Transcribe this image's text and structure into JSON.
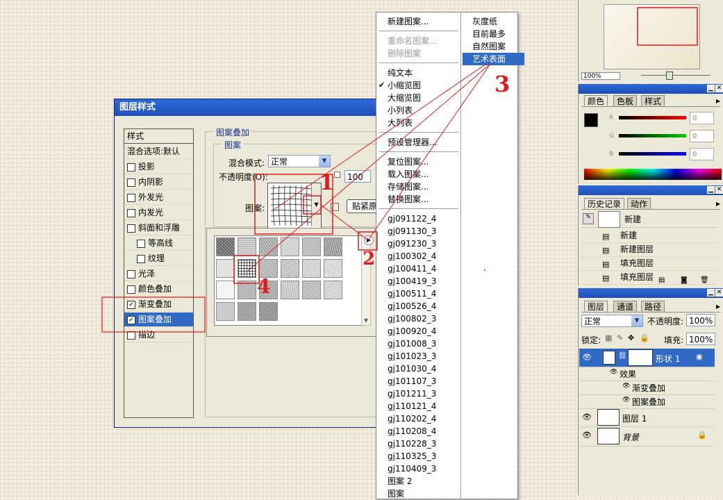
{
  "dialog": {
    "title": "图层样式",
    "styles_header": "样式",
    "blend_options": "混合选项:默认",
    "items": [
      {
        "label": "投影",
        "checked": false
      },
      {
        "label": "内阴影",
        "checked": false
      },
      {
        "label": "外发光",
        "checked": false
      },
      {
        "label": "内发光",
        "checked": false
      },
      {
        "label": "斜面和浮雕",
        "checked": false
      },
      {
        "label": "等高线",
        "checked": false
      },
      {
        "label": "纹理",
        "checked": false
      },
      {
        "label": "光泽",
        "checked": false
      },
      {
        "label": "颜色叠加",
        "checked": false
      },
      {
        "label": "渐变叠加",
        "checked": true
      },
      {
        "label": "图案叠加",
        "checked": true
      },
      {
        "label": "描边",
        "checked": false
      }
    ],
    "section_title": "图案叠加",
    "subsection_title": "图案",
    "blend_mode_label": "混合模式:",
    "blend_mode_value": "正常",
    "opacity_label": "不透明度(O):",
    "opacity_value": "100",
    "pattern_label": "图案:",
    "snap_button": "贴紧原"
  },
  "menu": {
    "col1": {
      "top": [
        "新建图案..."
      ],
      "disabled": [
        "重命名图案...",
        "删除图案"
      ],
      "view": [
        "纯文本",
        "小缩览图",
        "大缩览图",
        "小列表",
        "大列表"
      ],
      "checked_view": "小缩览图",
      "manager": "预设管理器...",
      "actions": [
        "复位图案...",
        "载入图案...",
        "存储图案...",
        "替换图案..."
      ],
      "patterns": [
        "gj091122_4",
        "gj091130_3",
        "gj091230_3",
        "gj100302_4",
        "gj100411_4",
        "gj100419_3",
        "gj100511_4",
        "gj100526_4",
        "gj100802_3",
        "gj100920_4",
        "gj101008_3",
        "gj101023_3",
        "gj101030_4",
        "gj101107_3",
        "gj101211_3",
        "gj110121_4",
        "gj110202_4",
        "gj110208_4",
        "gj110228_3",
        "gj110325_3",
        "gj110409_3",
        "图案 2",
        "图案"
      ]
    },
    "col2": [
      "灰度纸",
      "目前最多",
      "自然图案",
      "艺术表面"
    ],
    "col2_highlight": "艺术表面"
  },
  "panels": {
    "navigator": {
      "zoom": "100%"
    },
    "color": {
      "tabs": [
        "颜色",
        "色板",
        "样式"
      ],
      "channels": [
        "R",
        "G",
        "B"
      ],
      "values": [
        "0",
        "0",
        "0"
      ]
    },
    "history": {
      "tabs": [
        "历史记录",
        "动作"
      ],
      "snapshot": "新建",
      "rows": [
        "新建",
        "新建图层",
        "填充图层",
        "填充图层"
      ]
    },
    "layers": {
      "tabs": [
        "图层",
        "通道",
        "路径"
      ],
      "blend_mode": "正常",
      "opacity_label": "不透明度:",
      "opacity": "100%",
      "lock_label": "锁定:",
      "fill_label": "填充:",
      "fill": "100%",
      "shape_layer": "形状 1",
      "effects_label": "效果",
      "effects": [
        "渐变叠加",
        "图案叠加"
      ],
      "layer1": "图层 1",
      "background": "背景"
    }
  },
  "annotations": [
    "1",
    "2",
    "3",
    "4"
  ]
}
